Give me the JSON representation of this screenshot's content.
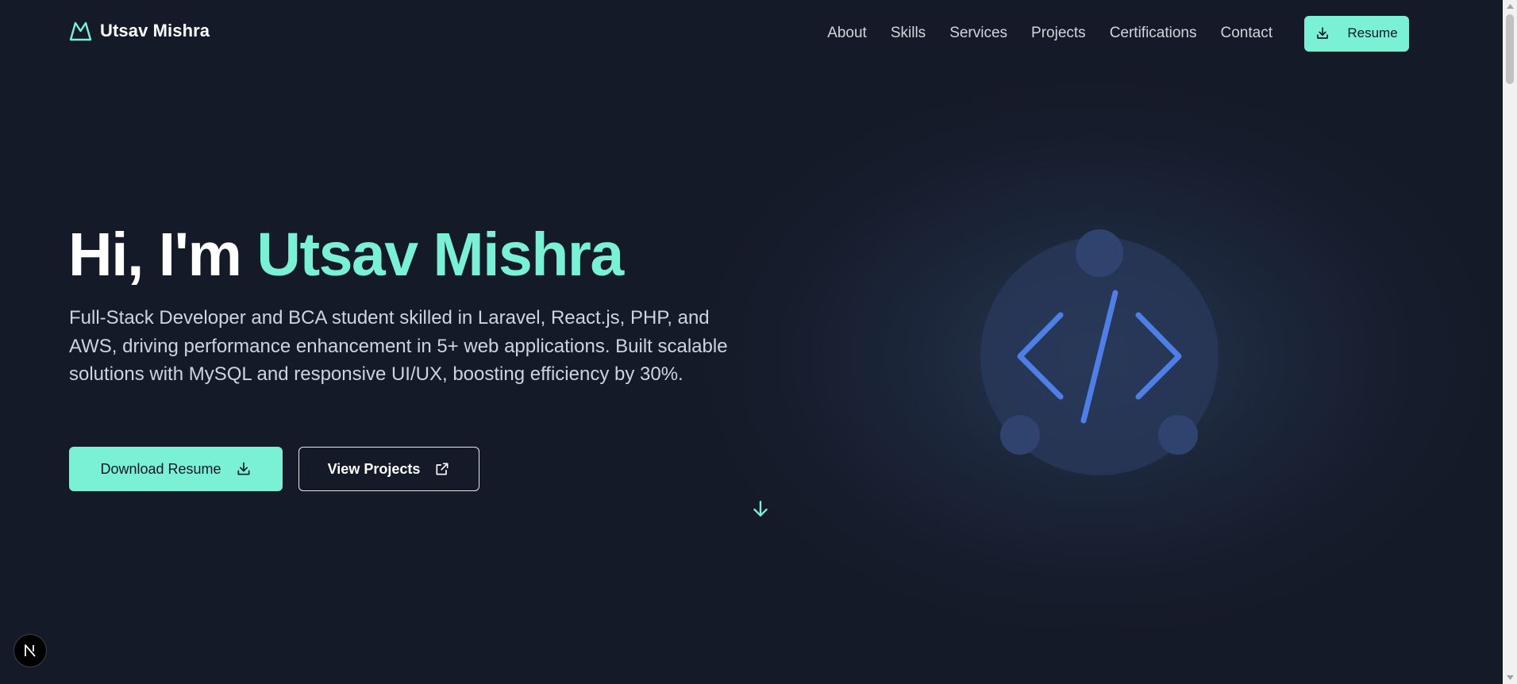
{
  "nav": {
    "brand_name": "Utsav Mishra",
    "brand_icon": "mountain-logo-icon",
    "links": [
      "About",
      "Skills",
      "Services",
      "Projects",
      "Certifications",
      "Contact"
    ],
    "resume_label": "Resume"
  },
  "hero": {
    "greeting": "Hi, I'm ",
    "name": "Utsav Mishra",
    "description": "Full-Stack Developer and BCA student skilled in Laravel, React.js, PHP, and AWS, driving performance enhancement in 5+ web applications. Built scalable solutions with MySQL and responsive UI/UX, boosting efficiency by 30%.",
    "primary_button": "Download Resume",
    "secondary_button": "View Projects"
  },
  "illustration": {
    "icon": "code-brackets-icon"
  },
  "badge": {
    "letter": "N"
  },
  "colors": {
    "background": "#151a28",
    "accent": "#7af0d4",
    "code_icon": "#4f7fe6"
  }
}
